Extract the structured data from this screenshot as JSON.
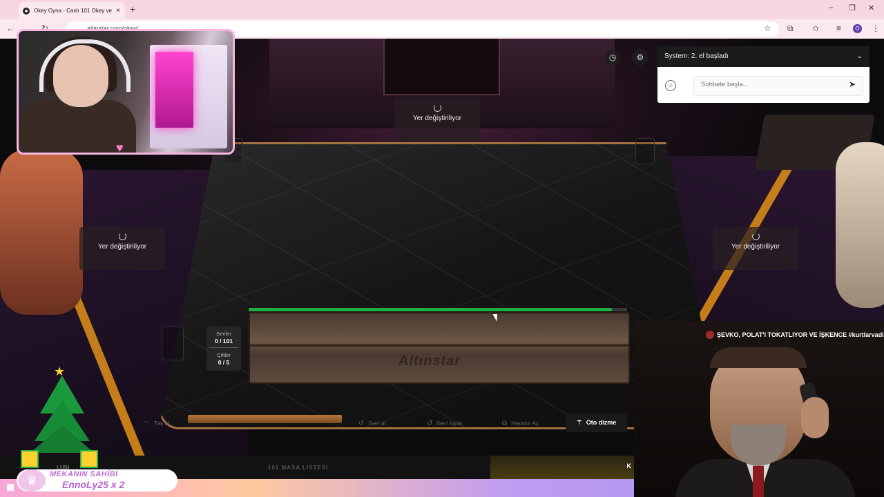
{
  "browser": {
    "tab_title": "Okey Oyna - Canlı 101 Okey ve",
    "tab_close": "×",
    "new_tab": "+",
    "url": "altinstar.com/okey/",
    "profile_initial": "O",
    "window_controls": [
      "–",
      "❐",
      "✕"
    ]
  },
  "game": {
    "seats": {
      "top": "Yer değiştiriliyor",
      "left": "Yer değiştiriliyor",
      "right": "Yer değiştiriliyor"
    },
    "rack_brand": "Altınstar",
    "progress_fraction": 0.96,
    "score": {
      "series_label": "Seriler",
      "series_value": "0 / 101",
      "pairs_label": "Çiftler",
      "pairs_value": "0 / 5"
    },
    "actions": {
      "tas_al": "Taş al",
      "geri_al": "Geri al",
      "geri_topla": "Geri topla",
      "hepsini_ac": "Hepsini Aç",
      "oto_dizme": "Oto dizme"
    },
    "bottom": {
      "left_label": "LUŞI",
      "table_list": "101 MASA LİSTESİ",
      "right_letter": "K"
    }
  },
  "chat": {
    "header": "System: 2. el başladı",
    "placeholder": "Sohbete başla..."
  },
  "stream_overlay": {
    "owner_role": "MEKANIN SAHİBİ",
    "owner_name": "EnnoLy25 x 2",
    "video_caption": "ŞEVKO, POLAT'I TOKATLIYOR VE İŞKENCE #kurtlarvadisi #po"
  },
  "colors": {
    "progress": "#1fae3f",
    "stripe": "#d78a1a",
    "cam_border": "#f6b8e2"
  }
}
